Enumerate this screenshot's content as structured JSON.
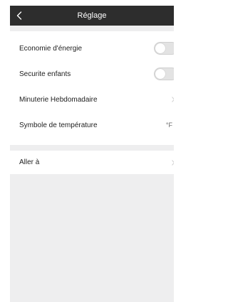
{
  "header": {
    "title": "Réglage",
    "back_icon": "chevron-left-icon"
  },
  "settings": {
    "energy_saving": {
      "label": "Economie d'énergie",
      "enabled": false
    },
    "child_lock": {
      "label": "Securite enfants",
      "enabled": false
    },
    "weekly_timer": {
      "label": "Minuterie Hebdomadaire"
    },
    "temperature_symbol": {
      "label": "Symbole de température",
      "value": "°F"
    }
  },
  "goto": {
    "label": "Aller à"
  },
  "colors": {
    "navbar": "#2d2d2d",
    "background": "#eeeeef",
    "toggle_off": "#e3e3e3"
  }
}
